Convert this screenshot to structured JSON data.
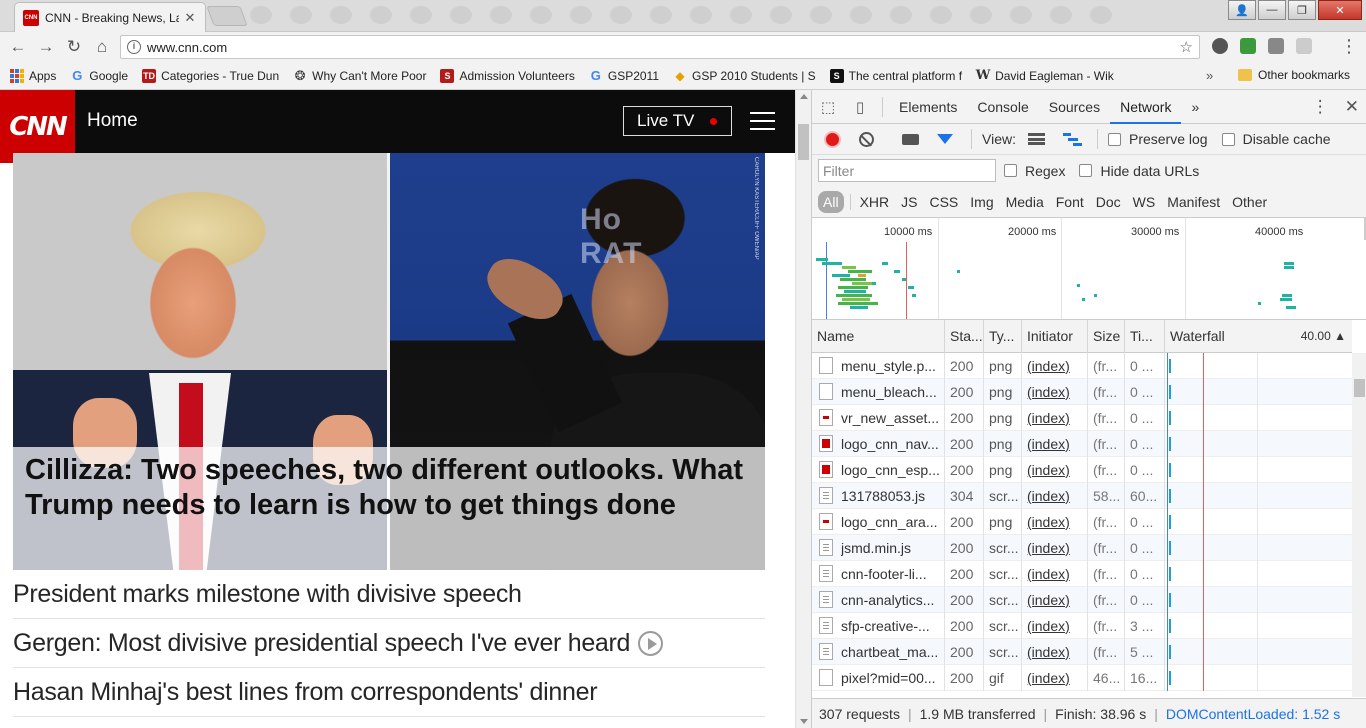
{
  "tab": {
    "title": "CNN - Breaking News, La",
    "favicon_text": "CNN"
  },
  "toolbar": {
    "url": "www.cnn.com"
  },
  "bookmarks": {
    "items": [
      {
        "label": "Apps",
        "color": "#d0402b"
      },
      {
        "label": "Google",
        "icon": "G",
        "color": "#4285f4"
      },
      {
        "label": "Categories - True Dun",
        "icon": "TD",
        "color": "#b31b1b"
      },
      {
        "label": "Why Can't More Poor",
        "icon": "❂",
        "color": "#333333"
      },
      {
        "label": "Admission Volunteers",
        "icon": "S",
        "color": "#b31b1b"
      },
      {
        "label": "GSP2011",
        "icon": "G",
        "color": "#4285f4"
      },
      {
        "label": "GSP 2010 Students | S",
        "icon": "◆",
        "color": "#e8a000"
      },
      {
        "label": "The central platform f",
        "icon": "S",
        "color": "#111111"
      },
      {
        "label": "David Eagleman - Wik",
        "icon": "W",
        "color": "#555555"
      }
    ],
    "more": "»",
    "other": "Other bookmarks"
  },
  "cnn": {
    "logo": "CNN",
    "nav_home": "Home",
    "live_tv": "Live TV",
    "hero_headline": "Cillizza: Two speeches, two different outlooks. What Trump needs to learn is how to get things done",
    "photo_credit": "CAROLYN KASTER/CLIFF OWEN/AP",
    "stories": [
      "President marks milestone with divisive speech",
      "Gergen: Most divisive presidential speech I've ever heard",
      "Hasan Minhaj's best lines from correspondents' dinner"
    ]
  },
  "devtools": {
    "tabs": [
      "Elements",
      "Console",
      "Sources",
      "Network"
    ],
    "active_tab": "Network",
    "more": "»",
    "view_label": "View:",
    "preserve_log": "Preserve log",
    "disable_cache": "Disable cache",
    "filter_placeholder": "Filter",
    "regex": "Regex",
    "hide_data_urls": "Hide data URLs",
    "types": [
      "All",
      "XHR",
      "JS",
      "CSS",
      "Img",
      "Media",
      "Font",
      "Doc",
      "WS",
      "Manifest",
      "Other"
    ],
    "overview_labels": [
      "10000 ms",
      "20000 ms",
      "30000 ms",
      "40000 ms"
    ],
    "columns": [
      "Name",
      "Sta...",
      "Ty...",
      "Initiator",
      "Size",
      "Ti...",
      "Waterfall"
    ],
    "waterfall_time": "40.00",
    "rows": [
      {
        "name": "menu_style.p...",
        "status": "200",
        "type": "png",
        "initiator": "(index)",
        "size": "(fr...",
        "time": "0 ...",
        "icon": "blank"
      },
      {
        "name": "menu_bleach...",
        "status": "200",
        "type": "png",
        "initiator": "(index)",
        "size": "(fr...",
        "time": "0 ...",
        "icon": "blank"
      },
      {
        "name": "vr_new_asset...",
        "status": "200",
        "type": "png",
        "initiator": "(index)",
        "size": "(fr...",
        "time": "0 ...",
        "icon": "redmini"
      },
      {
        "name": "logo_cnn_nav...",
        "status": "200",
        "type": "png",
        "initiator": "(index)",
        "size": "(fr...",
        "time": "0 ...",
        "icon": "red"
      },
      {
        "name": "logo_cnn_esp...",
        "status": "200",
        "type": "png",
        "initiator": "(index)",
        "size": "(fr...",
        "time": "0 ...",
        "icon": "red"
      },
      {
        "name": "131788053.js",
        "status": "304",
        "type": "scr...",
        "initiator": "(index)",
        "size": "58...",
        "time": "60...",
        "icon": "doc"
      },
      {
        "name": "logo_cnn_ara...",
        "status": "200",
        "type": "png",
        "initiator": "(index)",
        "size": "(fr...",
        "time": "0 ...",
        "icon": "redmini"
      },
      {
        "name": "jsmd.min.js",
        "status": "200",
        "type": "scr...",
        "initiator": "(index)",
        "size": "(fr...",
        "time": "0 ...",
        "icon": "doc"
      },
      {
        "name": "cnn-footer-li...",
        "status": "200",
        "type": "scr...",
        "initiator": "(index)",
        "size": "(fr...",
        "time": "0 ...",
        "icon": "doc"
      },
      {
        "name": "cnn-analytics...",
        "status": "200",
        "type": "scr...",
        "initiator": "(index)",
        "size": "(fr...",
        "time": "0 ...",
        "icon": "doc"
      },
      {
        "name": "sfp-creative-...",
        "status": "200",
        "type": "scr...",
        "initiator": "(index)",
        "size": "(fr...",
        "time": "3 ...",
        "icon": "doc"
      },
      {
        "name": "chartbeat_ma...",
        "status": "200",
        "type": "scr...",
        "initiator": "(index)",
        "size": "(fr...",
        "time": "5 ...",
        "icon": "doc"
      },
      {
        "name": "pixel?mid=00...",
        "status": "200",
        "type": "gif",
        "initiator": "(index)",
        "size": "46...",
        "time": "16...",
        "icon": "blank"
      }
    ],
    "status": {
      "requests": "307 requests",
      "transferred": "1.9 MB transferred",
      "finish": "Finish: 38.96 s",
      "dcl": "DOMContentLoaded: 1.52 s"
    }
  }
}
